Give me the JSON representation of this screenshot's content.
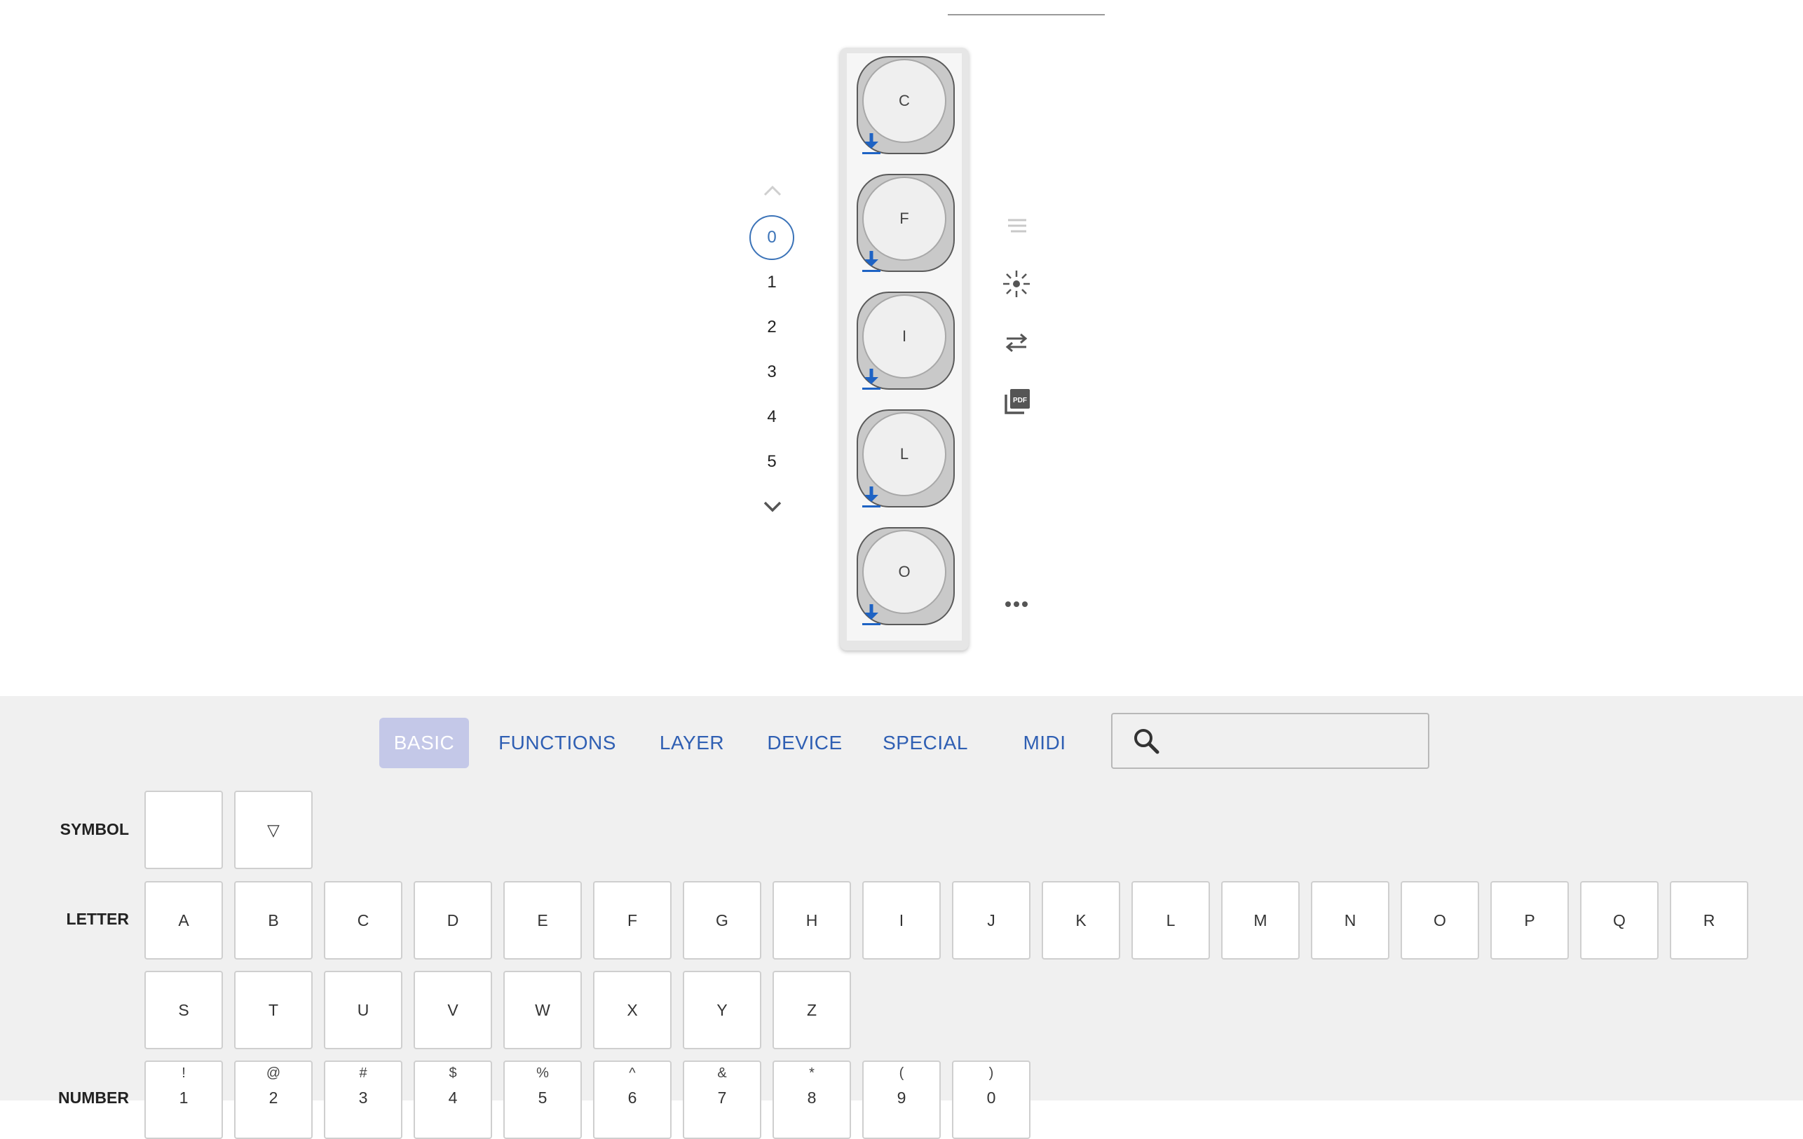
{
  "layers": {
    "items": [
      "0",
      "1",
      "2",
      "3",
      "4",
      "5"
    ],
    "active_index": 0
  },
  "keyboard": {
    "keys": [
      "C",
      "F",
      "I",
      "L",
      "O"
    ]
  },
  "tools": {
    "icons": [
      "lines-icon",
      "brightness-icon",
      "swap-icon",
      "pdf-icon",
      "more-icon"
    ]
  },
  "tabs": [
    {
      "label": "BASIC",
      "active": true
    },
    {
      "label": "FUNCTIONS",
      "active": false
    },
    {
      "label": "LAYER",
      "active": false
    },
    {
      "label": "DEVICE",
      "active": false
    },
    {
      "label": "SPECIAL",
      "active": false
    },
    {
      "label": "MIDI",
      "active": false
    }
  ],
  "search": {
    "value": "",
    "placeholder": ""
  },
  "keycode_groups": {
    "symbol": {
      "label": "SYMBOL",
      "keys": [
        "",
        "▽"
      ]
    },
    "letter": {
      "label": "LETTER",
      "keys": [
        "A",
        "B",
        "C",
        "D",
        "E",
        "F",
        "G",
        "H",
        "I",
        "J",
        "K",
        "L",
        "M",
        "N",
        "O",
        "P",
        "Q",
        "R",
        "S",
        "T",
        "U",
        "V",
        "W",
        "X",
        "Y",
        "Z"
      ]
    },
    "number": {
      "label": "NUMBER",
      "keys": [
        {
          "shift": "!",
          "base": "1"
        },
        {
          "shift": "@",
          "base": "2"
        },
        {
          "shift": "#",
          "base": "3"
        },
        {
          "shift": "$",
          "base": "4"
        },
        {
          "shift": "%",
          "base": "5"
        },
        {
          "shift": "^",
          "base": "6"
        },
        {
          "shift": "&",
          "base": "7"
        },
        {
          "shift": "*",
          "base": "8"
        },
        {
          "shift": "(",
          "base": "9"
        },
        {
          "shift": ")",
          "base": "0"
        }
      ]
    }
  },
  "colors": {
    "accent": "#2f5fb3",
    "active_tab_bg": "#c4c8e8",
    "panel_bg": "#f0f0f0",
    "marker_blue": "#1e63c4"
  }
}
